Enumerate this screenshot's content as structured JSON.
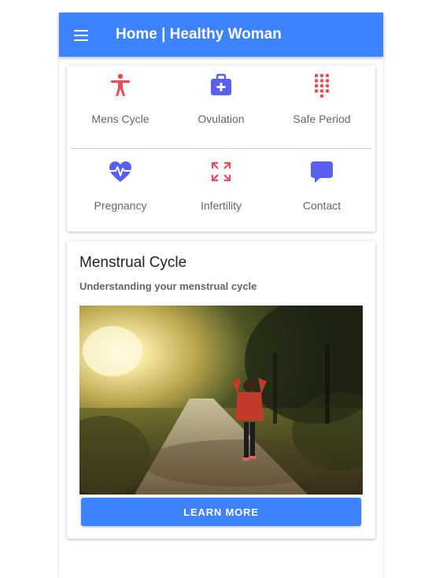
{
  "appbar": {
    "title": "Home | Healthy Woman",
    "icon": "menu-icon",
    "color": "#3d82ff"
  },
  "tiles": [
    {
      "label": "Mens Cycle",
      "icon": "human-figure-icon",
      "color": "#ef4a5a"
    },
    {
      "label": "Ovulation",
      "icon": "first-aid-bag-icon",
      "color": "#5b5ff0"
    },
    {
      "label": "Safe Period",
      "icon": "dot-grid-icon",
      "color": "#ef4a5a"
    },
    {
      "label": "Pregnancy",
      "icon": "heart-pulse-icon",
      "color": "#5b5ff0"
    },
    {
      "label": "Infertility",
      "icon": "expand-arrows-icon",
      "color": "#ef4a5a"
    },
    {
      "label": "Contact",
      "icon": "chat-bubble-icon",
      "color": "#5b5ff0"
    }
  ],
  "card": {
    "title": "Menstrual Cycle",
    "subtitle": "Understanding your menstrual cycle",
    "image": "woman-walking-on-sunlit-path-photo",
    "button_label": "LEARN MORE"
  }
}
